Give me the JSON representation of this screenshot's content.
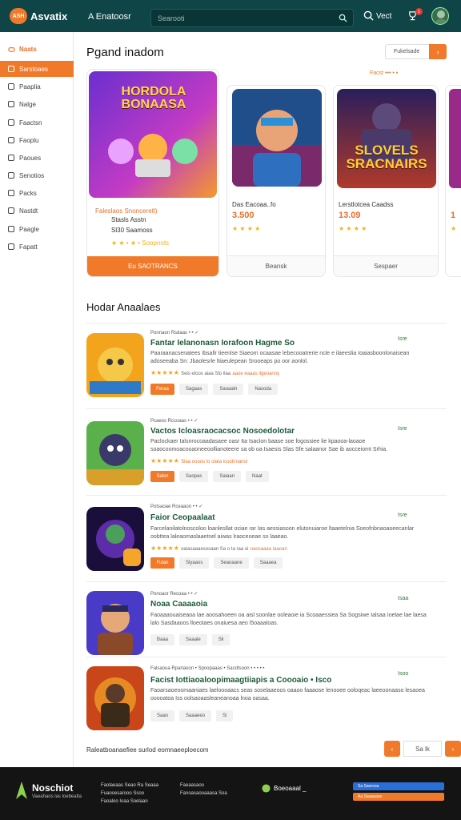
{
  "header": {
    "logo_badge": "ASH",
    "logo_text": "Asvatix",
    "link": "A Enatoosr",
    "search_placeholder": "Searooti",
    "notif_label": "Vect",
    "badge_count": "1"
  },
  "sidebar": {
    "heading": "Naats",
    "items": [
      {
        "label": "Sarstoaes",
        "active": true
      },
      {
        "label": "Paaplia"
      },
      {
        "label": "Nalge"
      },
      {
        "label": "Faactsn"
      },
      {
        "label": "Faoplu"
      },
      {
        "label": "Paoues"
      },
      {
        "label": "Senotios"
      },
      {
        "label": "Packs"
      },
      {
        "label": "Nastdt"
      },
      {
        "label": "Paagle"
      },
      {
        "label": "Fapatt"
      }
    ]
  },
  "featured": {
    "title": "Pgand inadom",
    "sort_label": "Fukelsade",
    "filters": "Facst  •••  •  •",
    "cards": [
      {
        "art": "HORDOLA BONAASA",
        "title": "Faleslaos Snonceretl)",
        "subtitle": "Stasls Asstn",
        "price": "Sl30 Saamoss",
        "stars": "★ ★ • ★ • Soopnots",
        "button": "Eu  SAOTRANCS",
        "primary": true
      },
      {
        "art": "",
        "title": "Das Eacoaa..fo",
        "price": "3.500",
        "stars": "★ ★ ★ ★",
        "button": "Beansk",
        "primary": false
      },
      {
        "art": "SLOVELS SRACNAIRS",
        "title": "Lerstlotcea  Caadss",
        "price": "13.09",
        "stars": "★ ★ ★ ★",
        "button": "Sespaer",
        "primary": false
      },
      {
        "art": "",
        "title": "",
        "price": "1",
        "stars": "★",
        "button": "",
        "primary": false
      }
    ]
  },
  "list": {
    "title": "Hodar Anaalaes",
    "rows": [
      {
        "meta": "Ponnaon  Rsdaas  •  • ✓",
        "title": "Fantar  Ielanonasn Iorafoon Hagme So",
        "desc": "Paaraanacsenatees  Ibsallr tieenlse  Siaeom  ocaasae lebecooatrerie  ncle  e ilaeeslia  Ioaiasboonlonaisean  adoseeaba Sn:  Jbaolesrle  ltiaeulepean  Srooeaps  po  oor aonlol.",
        "rating": "★★★★★",
        "rating_text": "Seis eloos aiaa    Slo  ilaa",
        "rating_hl": "aaoe eaaas ilgeoanoy",
        "buttons": [
          "Feraa",
          "Sagaas",
          "Saoaaln",
          "Nasoda"
        ],
        "right": "Isre"
      },
      {
        "meta": "Pcaeos  Rccoaas  •  • ✓",
        "title": "Vactos  Icloasraocacsoc Nosoedolotar",
        "desc": "Paclockaer  Ialsnrocoaadasaee oasr  Ita  Isaclon  baase  soe  fogossiee lie  kpaooa-laoaoe  soaocoomoacooaoneeoollianoteere  sa  ob oa  Isaesis  Slas  Sfe  salaanor  Sae  ib  aocceiomt Srhia.",
        "rating": "★★★★★",
        "rating_text": "",
        "rating_hl": "Slaa oooos lo  olata  icoolnnanoi",
        "buttons": [
          "Salsn",
          "Saopas",
          "Saiaan",
          "Naat"
        ],
        "right": "Isre"
      },
      {
        "meta": "Potsaoae  Rceaaon  •  • ✓",
        "title": "Faior  Ceopaalaat",
        "desc": "Farcelanilatolnoscoloo  loanlesllat  ociae  rar  Ias  aessiasoon  elutonuiaroe  ltaaetelnia  Soeofnbnaoaoeecanlar  oobttea  laleaomaslaaetnel  aiwas  lraoceoeae  so  laaeao.",
        "rating": "★★★★★",
        "rating_text": "oaiasaaaesosaan  Sa  o  ta  raa  oi",
        "rating_hl": "naosaaaa  laaoan",
        "buttons": [
          "Fulan",
          "Slyaaos",
          "Seaoaane",
          "Saaaea"
        ],
        "right": "Isre"
      },
      {
        "meta": "Ponoaor  Recoaa  •  • ✓",
        "title": "Noaa  Caaaaoia",
        "desc": "Faoaaaouaiseaoa  lae  aoosahoeen  oa  aisl  soonlae  ooleaoie ia  Scoaaessiea  Sa  Sogsiwe  Ialsaa  Ioelae lae  laesa  lalo  Sasdaaoos  lloeotaes  onaiuesa  aeo  l5oaaaloas.",
        "rating": "",
        "rating_text": "",
        "rating_hl": "",
        "buttons": [
          "Baaa",
          "Saaale",
          "Sli"
        ],
        "right": "Isaa"
      },
      {
        "meta": "Falsaoua  Rparlaoon  •  Spoopaaas  •  Sacdtsoon  •  •  •  •  •",
        "title": "Facist  Iottiaoaloopimaagtiiapis  a  Coooaio  •  Isco",
        "desc": "Faoarsaoeoomaaniaes  laeloooaacs  seas  soselaaeoos  oaaoo  faaaose  lenooee  ooloqeac  laeeoonaaso  lesaoea  ooooatoa  Iss  oolsaoaasleaneanoaa  lnoa  oasaa.",
        "rating": "",
        "rating_text": "",
        "rating_hl": "",
        "buttons": [
          "Saao",
          "Saaaeeo",
          "Si"
        ],
        "right": "Isoo"
      }
    ]
  },
  "pagination": {
    "info": "Raleatboanaefiee  surlod  eomnaeeploecom",
    "prev": "‹",
    "page": "Sa  lk",
    "next": "›"
  },
  "footer": {
    "brand": "Noschiot",
    "tagline": "Vaeahaos  las  loebealta",
    "col1": [
      "Faolaeaas  Seao  Ra  Seaaa",
      "Fuaooesarooo  Ssoo",
      "Faoaloo  Ioaa  Soelaan"
    ],
    "col2": [
      "Faeaasaoo",
      "Fanoasaooaaasa  Soa"
    ],
    "social": "Boeoaaal  _",
    "store1": "Sa  Saorooa",
    "store2": "Aa  Saoaaaoo"
  },
  "colors": {
    "accent": "#f07a2a",
    "header": "#0f4546",
    "link_green": "#1e5a3a"
  }
}
